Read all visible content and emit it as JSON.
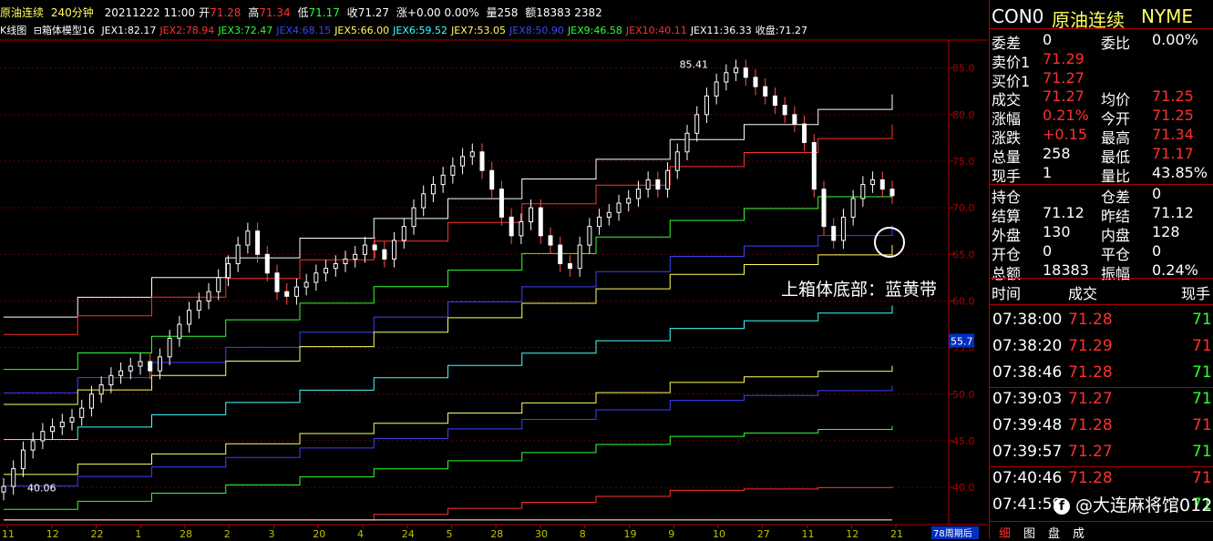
{
  "header": {
    "symbol_name": "原油连续",
    "period": "240分钟",
    "datetime": "20211222 11:00",
    "open_label": "开",
    "open": "71.28",
    "high_label": "高",
    "high": "71.34",
    "low_label": "低",
    "low": "71.17",
    "close_label": "收",
    "close": "71.27",
    "change_label": "涨",
    "change": "+0.00 0.00%",
    "volume_label": "量",
    "volume": "258",
    "amount_label": "额",
    "amount": "18383 2382"
  },
  "indicator_bar": {
    "k_label": "K线图",
    "model": "箱体模型16",
    "items": [
      {
        "text": "JEX1:82.17",
        "color": "#ffffff"
      },
      {
        "text": "JEX2:78.94",
        "color": "#ff3030"
      },
      {
        "text": "JEX3:72.47",
        "color": "#30ff30"
      },
      {
        "text": "JEX4:68.15",
        "color": "#4040ff"
      },
      {
        "text": "JEX5:66.00",
        "color": "#ffff60"
      },
      {
        "text": "JEX6:59.52",
        "color": "#40ffff"
      },
      {
        "text": "JEX7:53.05",
        "color": "#ffff60"
      },
      {
        "text": "JEX8:50.90",
        "color": "#4040ff"
      },
      {
        "text": "JEX9:46.58",
        "color": "#30ff30"
      },
      {
        "text": "JEX10:40.11",
        "color": "#ff3030"
      },
      {
        "text": "JEX11:36.33",
        "color": "#ffffff"
      },
      {
        "text": "收盘:71.27",
        "color": "#ffffff"
      }
    ]
  },
  "chart_data": {
    "type": "candlestick",
    "ylim": [
      36,
      88
    ],
    "y_ticks": [
      "85.0",
      "80.0",
      "75.0",
      "70.0",
      "65.0",
      "60.0",
      "55.0",
      "50.0",
      "45.0",
      "40.0"
    ],
    "x_ticks": [
      "11",
      "12",
      "22",
      "1",
      "28",
      "2",
      "3",
      "20",
      "4",
      "24",
      "5",
      "28",
      "30",
      "8",
      "19",
      "9",
      "10",
      "27",
      "11",
      "12",
      "21"
    ],
    "current_price_tag": "55.7",
    "annotations": {
      "high": "85.41",
      "low": "40.06",
      "note": "上箱体底部：蓝黄带"
    },
    "period_label": "78周期后",
    "close_series": [
      40.1,
      42,
      44,
      45,
      46,
      46.5,
      47,
      47.5,
      48.5,
      50,
      51,
      52,
      52.5,
      53,
      53.5,
      52.5,
      54,
      56,
      57.5,
      59,
      60,
      61,
      62.5,
      64,
      66,
      67.5,
      65,
      63,
      61,
      60.5,
      61.5,
      62,
      63,
      63.5,
      64,
      64.5,
      65,
      66,
      65.5,
      64.5,
      66.5,
      68,
      70,
      71.5,
      72.5,
      73.5,
      74.5,
      75.5,
      76,
      74,
      72,
      69,
      67,
      68.5,
      70,
      67,
      66,
      64,
      63.5,
      66,
      68,
      69,
      69.5,
      70.5,
      71,
      72,
      73,
      72,
      74,
      76,
      78,
      80,
      82,
      83.5,
      84.5,
      85,
      84,
      83,
      82,
      81,
      80,
      79,
      77,
      72,
      68,
      66.5,
      69,
      71,
      72.5,
      73,
      72,
      71.3
    ],
    "bands": [
      {
        "name": "JEX1",
        "color": "#ffffff",
        "value": 82.17
      },
      {
        "name": "JEX2",
        "color": "#ff3030",
        "value": 78.94
      },
      {
        "name": "JEX3",
        "color": "#30ff30",
        "value": 72.47
      },
      {
        "name": "JEX4",
        "color": "#4040ff",
        "value": 68.15
      },
      {
        "name": "JEX5",
        "color": "#ffff60",
        "value": 66.0
      },
      {
        "name": "JEX6",
        "color": "#40ffff",
        "value": 59.52
      },
      {
        "name": "JEX7",
        "color": "#ffff60",
        "value": 53.05
      },
      {
        "name": "JEX8",
        "color": "#4040ff",
        "value": 50.9
      },
      {
        "name": "JEX9",
        "color": "#30ff30",
        "value": 46.58
      },
      {
        "name": "JEX10",
        "color": "#ff3030",
        "value": 40.11
      },
      {
        "name": "JEX11",
        "color": "#ffffff",
        "value": 36.33
      }
    ]
  },
  "quote": {
    "code": "CON0",
    "name": "原油连续",
    "exchange": "NYME",
    "rows": [
      {
        "l1": "委差",
        "v1": "0",
        "c1": "#ffffff",
        "l2": "委比",
        "v2": "0.00%",
        "c2": "#ffffff"
      },
      {
        "l1": "卖价1",
        "v1": "71.29",
        "c1": "#ff3030",
        "l2": "",
        "v2": "",
        "c2": "#ffffff"
      },
      {
        "l1": "买价1",
        "v1": "71.27",
        "c1": "#ff3030",
        "l2": "",
        "v2": "",
        "c2": "#ffffff"
      },
      {
        "l1": "成交",
        "v1": "71.27",
        "c1": "#ff3030",
        "l2": "均价",
        "v2": "71.25",
        "c2": "#ff3030"
      },
      {
        "l1": "涨幅",
        "v1": "0.21%",
        "c1": "#ff3030",
        "l2": "今开",
        "v2": "71.25",
        "c2": "#ff3030"
      },
      {
        "l1": "涨跌",
        "v1": "+0.15",
        "c1": "#ff3030",
        "l2": "最高",
        "v2": "71.34",
        "c2": "#ff3030"
      },
      {
        "l1": "总量",
        "v1": "258",
        "c1": "#ffffff",
        "l2": "最低",
        "v2": "71.17",
        "c2": "#ff3030"
      },
      {
        "l1": "现手",
        "v1": "1",
        "c1": "#ffffff",
        "l2": "量比",
        "v2": "43.85%",
        "c2": "#ffffff"
      },
      {
        "l1": "持仓",
        "v1": "",
        "c1": "#ffffff",
        "l2": "仓差",
        "v2": "0",
        "c2": "#ffffff"
      },
      {
        "l1": "结算",
        "v1": "71.12",
        "c1": "#ffffff",
        "l2": "昨结",
        "v2": "71.12",
        "c2": "#ffffff"
      },
      {
        "l1": "外盘",
        "v1": "130",
        "c1": "#ffffff",
        "l2": "内盘",
        "v2": "128",
        "c2": "#ffffff"
      },
      {
        "l1": "开仓",
        "v1": "0",
        "c1": "#ffffff",
        "l2": "平仓",
        "v2": "0",
        "c2": "#ffffff"
      },
      {
        "l1": "总额",
        "v1": "18383",
        "c1": "#ffffff",
        "l2": "振幅",
        "v2": "0.24%",
        "c2": "#ffffff"
      }
    ]
  },
  "ticks": {
    "headers": {
      "time": "时间",
      "price": "成交",
      "vol": "现手"
    },
    "items": [
      {
        "time": "07:38:00",
        "price": "71.28",
        "vol": "71",
        "vcolor": "#30ff30"
      },
      {
        "time": "07:38:20",
        "price": "71.29",
        "vol": "71",
        "vcolor": "#ff3030"
      },
      {
        "time": "07:38:46",
        "price": "71.28",
        "vol": "71",
        "vcolor": "#30ff30"
      },
      {
        "time": "07:39:03",
        "price": "71.27",
        "vol": "71",
        "vcolor": "#30ff30"
      },
      {
        "time": "07:39:48",
        "price": "71.28",
        "vol": "71",
        "vcolor": "#ff3030"
      },
      {
        "time": "07:39:57",
        "price": "71.27",
        "vol": "71",
        "vcolor": "#30ff30"
      },
      {
        "time": "07:40:46",
        "price": "71.28",
        "vol": "71",
        "vcolor": "#ff3030"
      },
      {
        "time": "07:41:59",
        "price": "",
        "vol": "71",
        "vcolor": "#30ff30"
      }
    ]
  },
  "bottom_tabs": [
    "细",
    "图",
    "盘",
    "成"
  ],
  "watermark": "@大连麻将馆012"
}
